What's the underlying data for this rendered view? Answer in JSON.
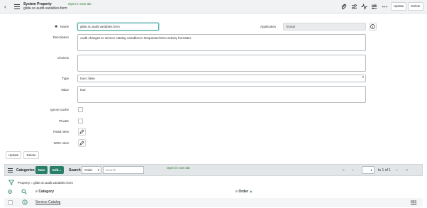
{
  "header": {
    "title": "System Property",
    "subtitle": "glide.sc.audit.variables.form",
    "open_new_tab": "Open in new tab",
    "update_label": "Update",
    "delete_label": "Delete",
    "icons": [
      "paperclip-icon",
      "sliders-icon",
      "activity-icon",
      "settings-icon",
      "more-icon"
    ]
  },
  "form": {
    "name_label": "Name",
    "name_value": "glide.sc.audit.variables.form",
    "application_label": "Application",
    "application_value": "Global",
    "description_label": "Description",
    "description_value": "Audit changes to service catalog variables in Requested Item activity formatter.",
    "choices_label": "Choices",
    "choices_value": "",
    "type_label": "Type",
    "type_value": "true | false",
    "value_label": "Value",
    "value_value": "true",
    "ignore_cache_label": "Ignore cache",
    "private_label": "Private",
    "read_roles_label": "Read roles",
    "write_roles_label": "Write roles"
  },
  "footer_buttons": {
    "update_label": "Update",
    "delete_label": "Delete"
  },
  "related_list": {
    "title": "Categories",
    "new_label": "New",
    "edit_label": "Edit...",
    "search_label": "Search",
    "order_select": "Order",
    "search_placeholder": "Search",
    "open_new_tab": "Open in new tab",
    "page_value": "1",
    "page_total": "to 1 of 1",
    "filter_text": "Property = glide.sc.audit.variables.form",
    "col_category": "Category",
    "col_order": "Order",
    "rows": [
      {
        "category": "Service Catalog",
        "order": "850"
      }
    ]
  },
  "colors": {
    "accent_green": "#278067",
    "link_green": "#2e7d32",
    "header_bg": "#f1f2f3"
  }
}
